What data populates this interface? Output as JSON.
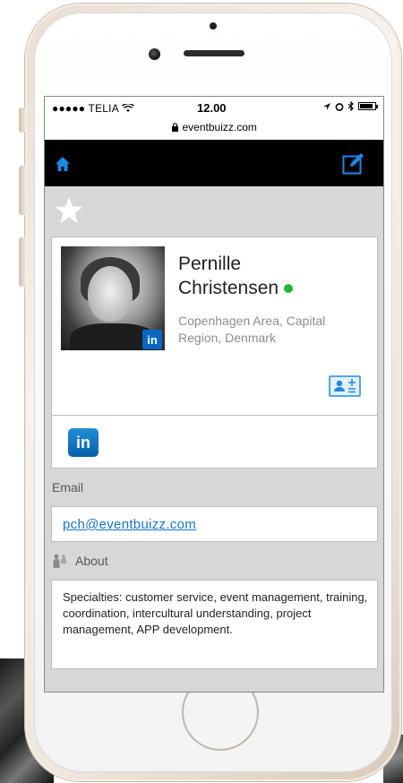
{
  "status_bar": {
    "carrier": "●●●●● TELIA",
    "wifi_icon": "wifi-icon",
    "time": "12.00",
    "url": "eventbuizz.com",
    "lock_icon": "lock-icon",
    "right_icons": "➚ ⏰ ✱ 🔋"
  },
  "header": {
    "home_icon": "home-icon",
    "edit_icon": "edit-icon",
    "color": "#000000",
    "accent": "#1e88e5"
  },
  "favorite": {
    "star_icon": "star-icon"
  },
  "profile": {
    "first_name": "Pernille",
    "last_name": "Christensen",
    "online_status_color": "#22b534",
    "location": "Copenhagen Area, Capital Region, Denmark",
    "avatar_badge": "in",
    "vcard_icon": "add-contact-icon"
  },
  "social": {
    "linkedin_label": "in"
  },
  "email": {
    "label": "Email",
    "value": "pch@eventbuizz.com"
  },
  "about": {
    "label": "About",
    "text": "Specialties: customer service, event management, training, coordination, intercultural understanding, project management, APP development."
  }
}
